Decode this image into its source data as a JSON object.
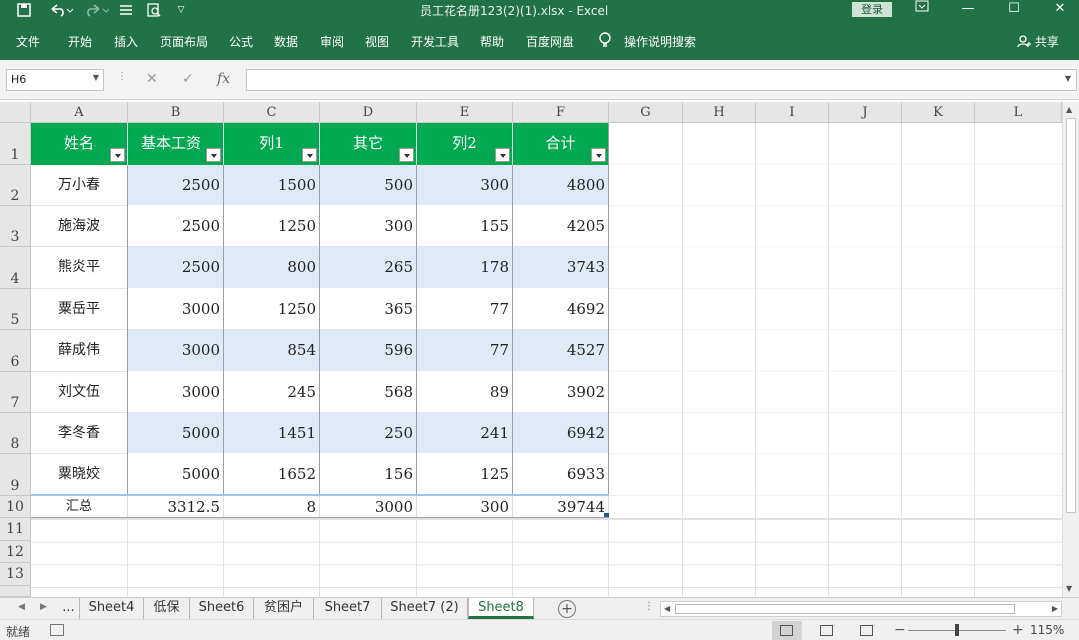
{
  "titlebar": {
    "document_title": "员工花名册123(2)(1).xlsx  -  Excel",
    "login_label": "登录",
    "quick_access_icons": [
      "save-icon",
      "undo-icon",
      "redo-icon",
      "form-icon",
      "print-preview-icon",
      "customize-dropdown-icon"
    ],
    "window_buttons": [
      "ribbon-display-icon",
      "minimize-icon",
      "maximize-icon",
      "close-icon"
    ]
  },
  "ribbon": {
    "tabs": [
      "文件",
      "开始",
      "插入",
      "页面布局",
      "公式",
      "数据",
      "审阅",
      "视图",
      "开发工具",
      "帮助",
      "百度网盘"
    ],
    "tell_me": "操作说明搜索",
    "share": "共享"
  },
  "formula_bar": {
    "name_box": "H6",
    "formula": "",
    "fx_label": "fx"
  },
  "grid": {
    "columns": [
      "A",
      "B",
      "C",
      "D",
      "E",
      "F",
      "G",
      "H",
      "I",
      "J",
      "K",
      "L"
    ],
    "rows": [
      "1",
      "2",
      "3",
      "4",
      "5",
      "6",
      "7",
      "8",
      "9",
      "10",
      "11",
      "12",
      "13"
    ],
    "table_headers": [
      "姓名",
      "基本工资",
      "列1",
      "其它",
      "列2",
      "合计"
    ],
    "table_rows": [
      [
        "万小春",
        "2500",
        "1500",
        "500",
        "300",
        "4800"
      ],
      [
        "施海波",
        "2500",
        "1250",
        "300",
        "155",
        "4205"
      ],
      [
        "熊炎平",
        "2500",
        "800",
        "265",
        "178",
        "3743"
      ],
      [
        "粟岳平",
        "3000",
        "1250",
        "365",
        "77",
        "4692"
      ],
      [
        "薛成伟",
        "3000",
        "854",
        "596",
        "77",
        "4527"
      ],
      [
        "刘文伍",
        "3000",
        "245",
        "568",
        "89",
        "3902"
      ],
      [
        "李冬香",
        "5000",
        "1451",
        "250",
        "241",
        "6942"
      ],
      [
        "粟晓姣",
        "5000",
        "1652",
        "156",
        "125",
        "6933"
      ]
    ],
    "summary_row": [
      "汇总",
      "3312.5",
      "8",
      "3000",
      "300",
      "39744"
    ],
    "colors": {
      "header_fill": "#00a84f",
      "band_fill": "#dfeaf7",
      "accent": "#217346"
    }
  },
  "sheets": {
    "tabs": [
      "...",
      "Sheet4",
      "低保",
      "Sheet6",
      "贫困户",
      "Sheet7",
      "Sheet7 (2)",
      "Sheet8"
    ],
    "active": "Sheet8"
  },
  "statusbar": {
    "ready": "就绪",
    "zoom": "115%",
    "zoom_minus": "−",
    "zoom_plus": "+"
  }
}
